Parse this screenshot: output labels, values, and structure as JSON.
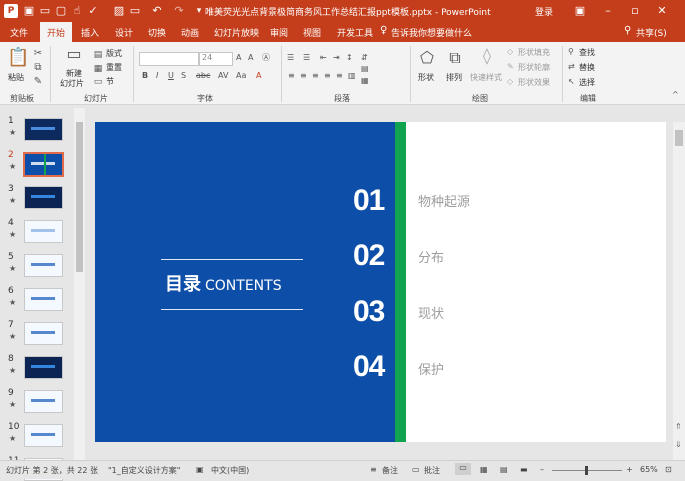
{
  "window": {
    "title": "唯美荧光光点背景极简商务风工作总结汇报ppt模板.pptx - PowerPoint",
    "login": "登录",
    "qat_icons": [
      "powerpoint-logo-icon",
      "save-icon",
      "open-icon",
      "new-icon",
      "touch-mode-icon",
      "check-icon",
      "image-icon",
      "undo-icon",
      "redo-icon",
      "present-icon",
      "customize-icon"
    ]
  },
  "tabs": [
    "文件",
    "开始",
    "插入",
    "设计",
    "切换",
    "动画",
    "幻灯片放映",
    "审阅",
    "视图",
    "开发工具"
  ],
  "tell_me": "告诉我你想要做什么",
  "share": "共享(S)",
  "ribbon": {
    "clipboard": {
      "paste": "粘贴",
      "label": "剪贴板"
    },
    "slides": {
      "new_slide_line1": "新建",
      "new_slide_line2": "幻灯片",
      "layout": "版式",
      "reset": "重置",
      "section": "节",
      "label": "幻灯片"
    },
    "font": {
      "size": "24",
      "label": "字体"
    },
    "paragraph": {
      "label": "段落"
    },
    "drawing": {
      "shape": "形状",
      "arrange": "排列",
      "quick_styles": "快速样式",
      "shape_fill": "形状填充",
      "shape_outline": "形状轮廓",
      "shape_effects": "形状效果",
      "label": "绘图"
    },
    "editing": {
      "find": "查找",
      "replace": "替换",
      "select": "选择",
      "label": "编辑"
    }
  },
  "thumbnails": [
    {
      "num": "1",
      "bg": "#0d2a5e",
      "accent": "#5aa8ff"
    },
    {
      "num": "2",
      "bg": "#0d4fa8",
      "accent": "#ffffff",
      "selected": true
    },
    {
      "num": "3",
      "bg": "#0b2454",
      "accent": "#3fa0ff"
    },
    {
      "num": "4",
      "bg": "#f4f8ff",
      "accent": "#8fb3e6"
    },
    {
      "num": "5",
      "bg": "#f4f8ff",
      "accent": "#2d6cc0"
    },
    {
      "num": "6",
      "bg": "#f4f8ff",
      "accent": "#2d6cc0"
    },
    {
      "num": "7",
      "bg": "#f4f8ff",
      "accent": "#2d6cc0"
    },
    {
      "num": "8",
      "bg": "#0b2454",
      "accent": "#3fa0ff"
    },
    {
      "num": "9",
      "bg": "#f4f8ff",
      "accent": "#2d6cc0"
    },
    {
      "num": "10",
      "bg": "#f4f8ff",
      "accent": "#2d6cc0"
    },
    {
      "num": "11",
      "bg": "#f4f8ff",
      "accent": "#2d6cc0"
    }
  ],
  "slide": {
    "heading_cn": "目录",
    "heading_en": "CONTENTS",
    "items": [
      {
        "num": "01",
        "text": "物种起源"
      },
      {
        "num": "02",
        "text": "分布"
      },
      {
        "num": "03",
        "text": "现状"
      },
      {
        "num": "04",
        "text": "保护"
      }
    ],
    "colors": {
      "blue": "#0d4fa8",
      "green": "#12a351",
      "item_text": "#9d9d9d"
    }
  },
  "status": {
    "slide_info": "幻灯片 第 2 张，共 22 张",
    "theme": "\"1_自定义设计方案\"",
    "language": "中文(中国)",
    "notes": "备注",
    "comments": "批注",
    "zoom": "65%"
  },
  "colors": {
    "accent": "#c43e1c"
  }
}
